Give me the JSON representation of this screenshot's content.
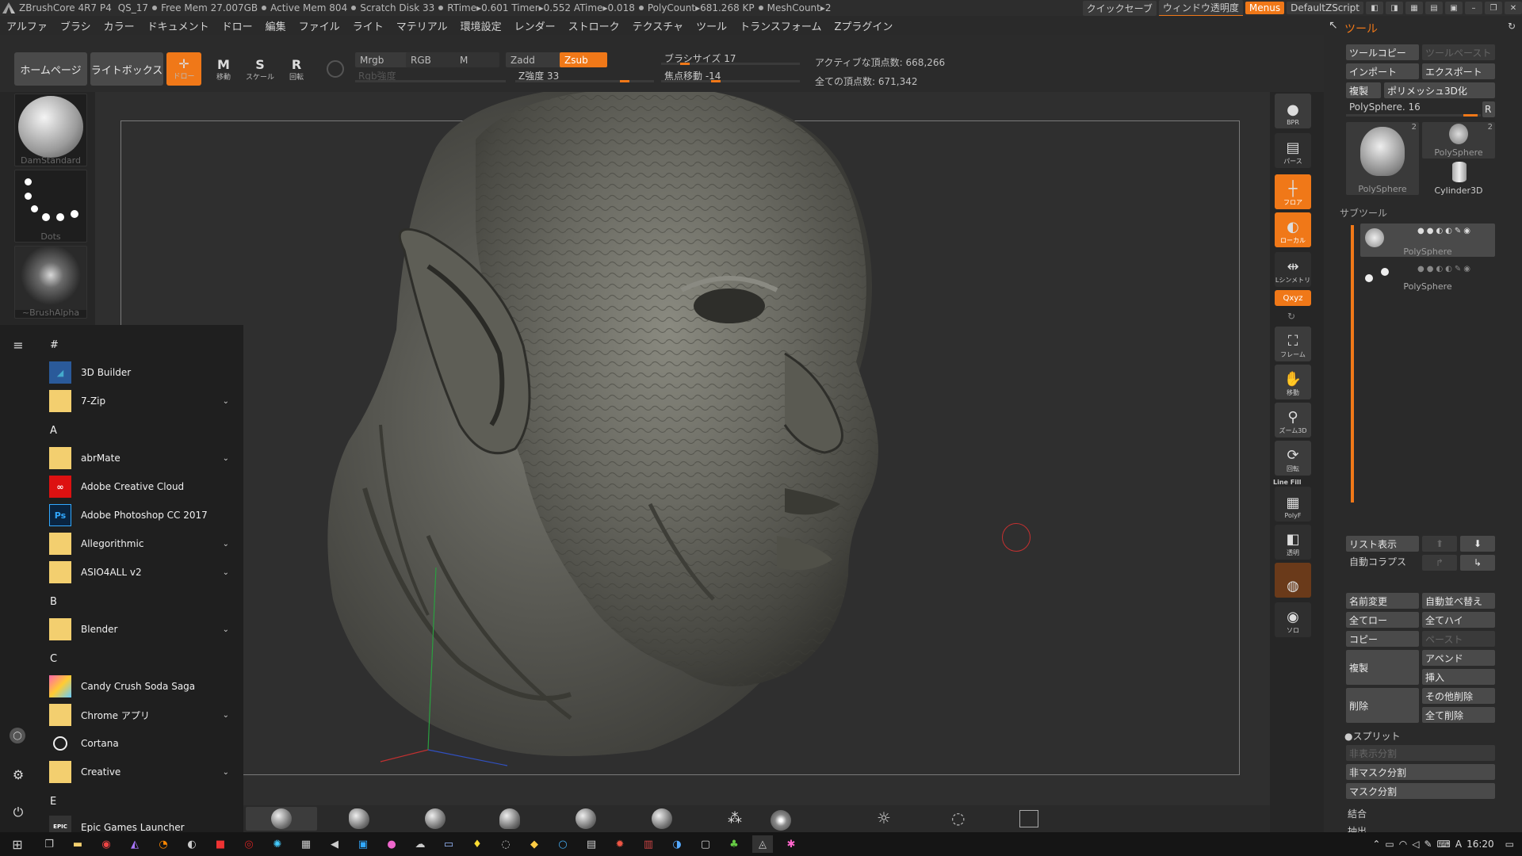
{
  "titlebar": {
    "app": "ZBrushCore 4R7 P4",
    "qs": "QS_17",
    "free_mem": "Free Mem 27.007GB",
    "active_mem": "Active Mem 804",
    "scratch": "Scratch Disk 33",
    "timing": "RTime▸0.601 Timer▸0.552 ATime▸0.018",
    "polycount": "PolyCount▸681.268 KP",
    "meshcount": "MeshCount▸2",
    "quicksave": "クイックセーブ",
    "transparency": "ウィンドウ透明度",
    "menus": "Menus",
    "script": "DefaultZScript"
  },
  "menu": [
    "アルファ",
    "ブラシ",
    "カラー",
    "ドキュメント",
    "ドロー",
    "編集",
    "ファイル",
    "ライト",
    "マテリアル",
    "環境設定",
    "レンダー",
    "ストローク",
    "テクスチャ",
    "ツール",
    "トランスフォーム",
    "Zプラグイン"
  ],
  "toolbar": {
    "home": "ホームページ",
    "lightbox": "ライトボックス",
    "draw_label": "ドロー",
    "move_label": "移動",
    "scale_label": "スケール",
    "rotate_label": "回転",
    "move_glyph": "M",
    "scale_glyph": "S",
    "rotate_glyph": "R",
    "mrgb": "Mrgb",
    "rgb": "RGB",
    "m": "M",
    "rgb_intensity": "Rgb強度",
    "zadd": "Zadd",
    "zsub": "Zsub",
    "z_intensity": "Z強度 33",
    "z_intensity_value": 0.33,
    "brush_size": "ブラシサイズ 17",
    "brush_size_value": 0.17,
    "focal_shift": "焦点移動 -14",
    "focal_shift_value": -0.14,
    "active_points": "アクティブな頂点数: 668,266",
    "total_points": "全ての頂点数: 671,342"
  },
  "brushes": [
    "DamStandard",
    "Dots",
    "~BrushAlpha"
  ],
  "right_tools": [
    {
      "id": "bpr",
      "label": "BPR",
      "glyph": "●",
      "active": false
    },
    {
      "id": "persp",
      "label": "パース",
      "glyph": "▤",
      "active": false
    },
    {
      "id": "floor",
      "label": "フロア",
      "glyph": "┼",
      "active": true
    },
    {
      "id": "local",
      "label": "ローカル",
      "glyph": "◐",
      "active": true
    },
    {
      "id": "sym",
      "label": "Lシンメトリ",
      "glyph": "⇹",
      "active": false
    },
    {
      "id": "xyz",
      "label": "",
      "glyph": "Qxyz",
      "active": true
    },
    {
      "id": "frame",
      "label": "フレーム",
      "glyph": "⛶",
      "active": false
    },
    {
      "id": "move",
      "label": "移動",
      "glyph": "✋",
      "active": false
    },
    {
      "id": "zoom",
      "label": "ズーム3D",
      "glyph": "⚲",
      "active": false
    },
    {
      "id": "rotate",
      "label": "回転",
      "glyph": "⟳",
      "active": false
    },
    {
      "id": "polyf",
      "label": "PolyF",
      "glyph": "▦",
      "active": false
    },
    {
      "id": "transp",
      "label": "透明",
      "glyph": "◧",
      "active": false
    },
    {
      "id": "ghost",
      "label": "",
      "glyph": "◍",
      "active": false
    },
    {
      "id": "solo",
      "label": "ソロ",
      "glyph": "◉",
      "active": false
    }
  ],
  "linefill": "Line Fill",
  "tool_panel": {
    "title": "ツール",
    "copy_tool": "ツールコピー",
    "paste_tool": "ツールペースト",
    "import": "インポート",
    "export": "エクスポート",
    "clone": "複製",
    "polymesh": "ポリメッシュ3D化",
    "polysphere_slider": "PolySphere. 16",
    "r_button": "R",
    "thumbs": [
      {
        "name": "PolySphere",
        "count": "2"
      },
      {
        "name": "PolySphere",
        "count": "2"
      },
      {
        "name": "Cylinder3D",
        "count": ""
      }
    ],
    "subtool_title": "サブツール",
    "subtools": [
      "PolySphere",
      "PolySphere"
    ],
    "list_view": "リスト表示",
    "auto_collapse": "自動コラプス",
    "rename": "名前変更",
    "auto_reorder": "自動並べ替え",
    "all_low": "全てロー",
    "all_high": "全てハイ",
    "copy": "コピー",
    "paste": "ペースト",
    "duplicate": "複製",
    "append": "アペンド",
    "insert": "挿入",
    "delete": "削除",
    "delete_other": "その他削除",
    "delete_all": "全て削除",
    "split": "●スプリット",
    "split_hidden": "非表示分割",
    "split_unmasked": "非マスク分割",
    "split_masked": "マスク分割",
    "merge": "結合",
    "extract": "抽出"
  },
  "start_menu": {
    "sections": [
      {
        "header": "#",
        "items": [
          {
            "name": "3D Builder",
            "icon": "builder",
            "folder": false
          },
          {
            "name": "7-Zip",
            "icon": "folder",
            "folder": true
          }
        ]
      },
      {
        "header": "A",
        "items": [
          {
            "name": "abrMate",
            "icon": "folder",
            "folder": true
          },
          {
            "name": "Adobe Creative Cloud",
            "icon": "cc",
            "folder": false
          },
          {
            "name": "Adobe Photoshop CC 2017",
            "icon": "ps",
            "folder": false
          },
          {
            "name": "Allegorithmic",
            "icon": "folder",
            "folder": true
          },
          {
            "name": "ASIO4ALL v2",
            "icon": "folder",
            "folder": true
          }
        ]
      },
      {
        "header": "B",
        "items": [
          {
            "name": "Blender",
            "icon": "folder",
            "folder": true
          }
        ]
      },
      {
        "header": "C",
        "items": [
          {
            "name": "Candy Crush Soda Saga",
            "icon": "candy",
            "folder": false
          },
          {
            "name": "Chrome アプリ",
            "icon": "folder",
            "folder": true
          },
          {
            "name": "Cortana",
            "icon": "cortana",
            "folder": false
          },
          {
            "name": "Creative",
            "icon": "folder",
            "folder": true
          }
        ]
      },
      {
        "header": "E",
        "items": [
          {
            "name": "Epic Games Launcher",
            "icon": "epic",
            "folder": false
          }
        ]
      }
    ],
    "ps_glyph": "Ps",
    "epic_glyph": "EPIC"
  },
  "taskbar": {
    "ime": "A",
    "time": "16:20"
  },
  "colors": {
    "accent": "#f07818",
    "panel": "#2a2a2a",
    "canvas": "#2f2f2f"
  }
}
